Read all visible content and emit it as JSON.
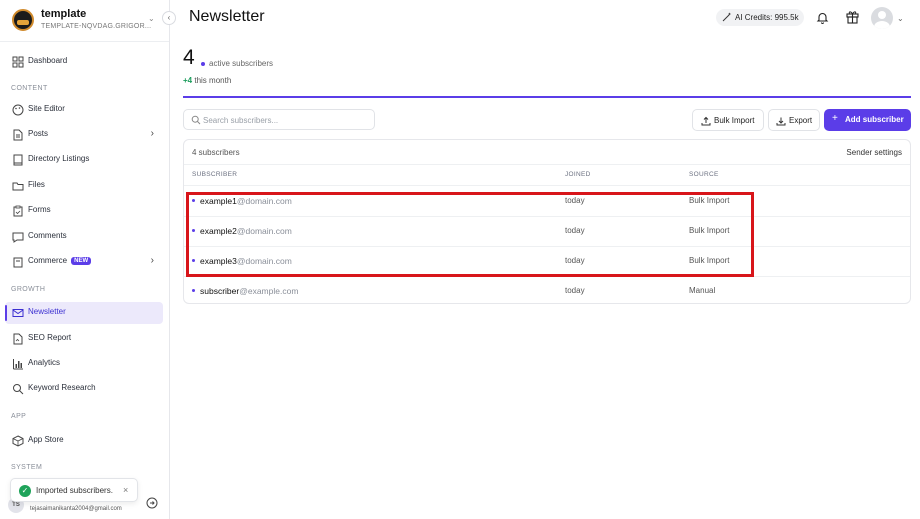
{
  "workspace": {
    "name": "template",
    "subtitle": "TEMPLATE-NQVDAG.GRIGOR..."
  },
  "sidebar": {
    "dashboard": "Dashboard",
    "content_label": "CONTENT",
    "site_editor": "Site Editor",
    "posts": "Posts",
    "directory_listings": "Directory Listings",
    "files": "Files",
    "forms": "Forms",
    "comments": "Comments",
    "commerce": "Commerce",
    "commerce_badge": "NEW",
    "growth_label": "GROWTH",
    "newsletter": "Newsletter",
    "seo_report": "SEO Report",
    "analytics": "Analytics",
    "keyword_research": "Keyword Research",
    "app_label": "APP",
    "app_store": "App Store",
    "system_label": "SYSTEM"
  },
  "user": {
    "initials": "TS",
    "email": "tejasaimanikanta2004@gmail.com"
  },
  "toast": {
    "message": "Imported subscribers."
  },
  "header": {
    "title": "Newsletter",
    "ai_credits": "AI Credits: 995.5k"
  },
  "stats": {
    "count": "4",
    "label": "active subscribers",
    "delta": "+4",
    "delta_label": "this month"
  },
  "toolbar": {
    "search_placeholder": "Search subscribers...",
    "search_value": "",
    "bulk_import": "Bulk Import",
    "export": "Export",
    "add_subscriber": "Add subscriber"
  },
  "table": {
    "count_label": "4 subscribers",
    "sender_settings": "Sender settings",
    "headers": [
      "SUBSCRIBER",
      "JOINED",
      "SOURCE"
    ],
    "rows": [
      {
        "user": "example1",
        "domain": "@domain.com",
        "joined": "today",
        "source": "Bulk Import"
      },
      {
        "user": "example2",
        "domain": "@domain.com",
        "joined": "today",
        "source": "Bulk Import"
      },
      {
        "user": "example3",
        "domain": "@domain.com",
        "joined": "today",
        "source": "Bulk Import"
      },
      {
        "user": "subscriber",
        "domain": "@example.com",
        "joined": "today",
        "source": "Manual"
      }
    ]
  },
  "colors": {
    "accent": "#5b3de8",
    "highlight": "#d8151a",
    "success": "#1fa35a"
  },
  "icons": [
    "dashboard-icon",
    "site-editor-icon",
    "posts-icon",
    "directory-icon",
    "files-icon",
    "forms-icon",
    "comments-icon",
    "commerce-icon",
    "newsletter-icon",
    "seo-icon",
    "analytics-icon",
    "keyword-icon",
    "app-store-icon",
    "search-icon",
    "upload-icon",
    "download-icon",
    "plus-icon",
    "bell-icon",
    "gift-icon",
    "magic-wand-icon",
    "logout-icon",
    "check-icon",
    "close-icon"
  ]
}
